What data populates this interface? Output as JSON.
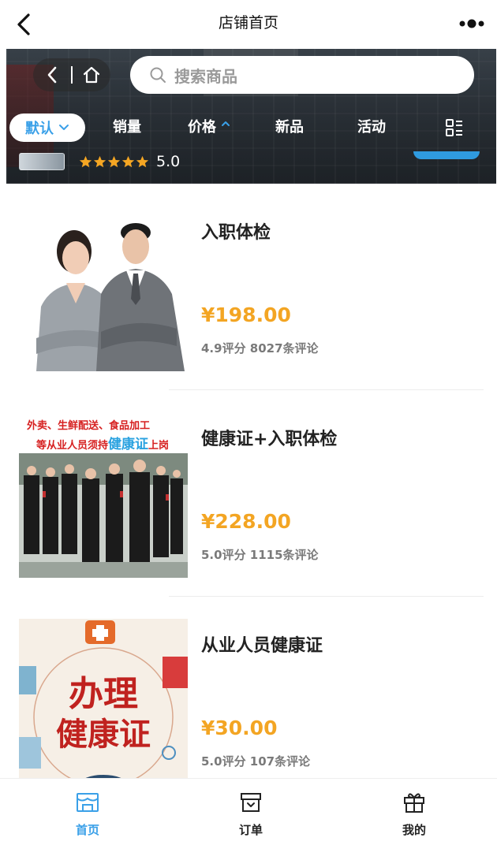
{
  "topbar": {
    "title": "店铺首页"
  },
  "store": {
    "search_placeholder": "搜索商品",
    "rating": "5.0",
    "stars": 5,
    "sort": [
      {
        "label": "默认",
        "active": true
      },
      {
        "label": "销量"
      },
      {
        "label": "价格"
      },
      {
        "label": "新品"
      },
      {
        "label": "活动"
      }
    ]
  },
  "products": [
    {
      "name": "入职体检",
      "price": "¥198.00",
      "meta": "4.9评分 8027条评论"
    },
    {
      "name": "健康证+入职体检",
      "price": "¥228.00",
      "meta": "5.0评分 1115条评论",
      "banner_line1": "外卖、生鲜配送、食品加工",
      "banner_line2_a": "等从业人员须持",
      "banner_line2_b": "健康证",
      "banner_line2_c": "上岗"
    },
    {
      "name": "从业人员健康证",
      "price": "¥30.00",
      "meta": "5.0评分 107条评论",
      "poster_line1": "办理",
      "poster_line2": "健康证"
    }
  ],
  "tabs": [
    {
      "label": "首页",
      "active": true
    },
    {
      "label": "订单"
    },
    {
      "label": "我的"
    }
  ],
  "colors": {
    "accent": "#3aa0e8",
    "price": "#f3a523",
    "star": "#f5a623"
  }
}
